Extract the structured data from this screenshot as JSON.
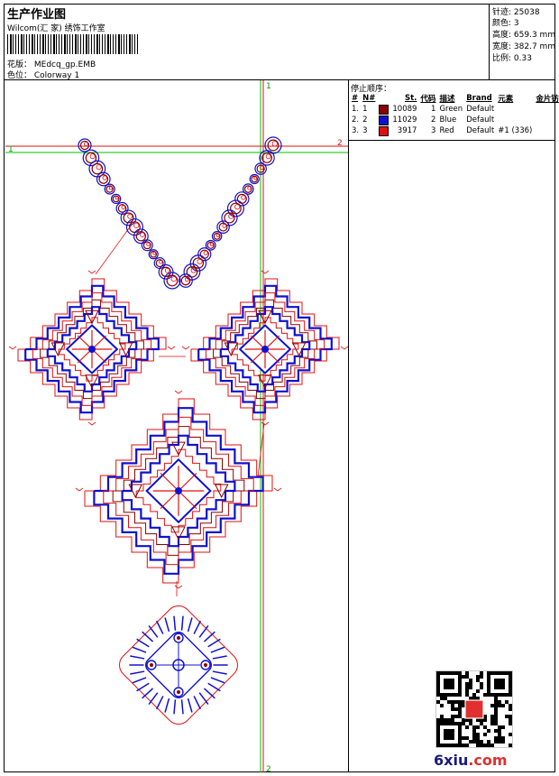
{
  "header": {
    "title": "生产作业图",
    "subtitle": "Wilcom(汇 家) 绣饰工作室",
    "design_label": "花版：",
    "design_value": "MEdcq_gp.EMB",
    "colorway_label": "色位：",
    "colorway_value": "Colorway 1"
  },
  "stats": [
    {
      "label": "针迹:",
      "value": "25038"
    },
    {
      "label": "颜色:",
      "value": "3"
    },
    {
      "label": "高度:",
      "value": "659.3 mm"
    },
    {
      "label": "宽度:",
      "value": "382.7 mm"
    },
    {
      "label": "比例:",
      "value": "0.33"
    }
  ],
  "stop_panel": {
    "title": "停止顺序：",
    "columns": [
      "#",
      "N#",
      "St.",
      "代码",
      "描述",
      "Brand",
      "元素",
      "金片钫"
    ],
    "rows": [
      {
        "idx": "1.",
        "n": "1",
        "color": "#8b0000",
        "st": "10089",
        "code": "1",
        "desc": "Green",
        "brand": "Default",
        "elem": "",
        "seq": ""
      },
      {
        "idx": "2.",
        "n": "2",
        "color": "#1010d0",
        "st": "11029",
        "code": "2",
        "desc": "Blue",
        "brand": "Default",
        "elem": "",
        "seq": ""
      },
      {
        "idx": "3.",
        "n": "3",
        "color": "#e01010",
        "st": "3917",
        "code": "3",
        "desc": "Red",
        "brand": "Default",
        "elem": "#1 (336)",
        "seq": ""
      }
    ]
  },
  "guides": {
    "v_top": "1",
    "v_bottom": "2",
    "h_left": "1",
    "h_right": "2"
  },
  "colors": {
    "red": "#e01010",
    "blue": "#1010d0",
    "dark": "#8b0000",
    "green": "#00c000"
  },
  "watermark": {
    "site": "6xiu.com",
    "site_a": "6xiu",
    "site_b": ".com"
  }
}
